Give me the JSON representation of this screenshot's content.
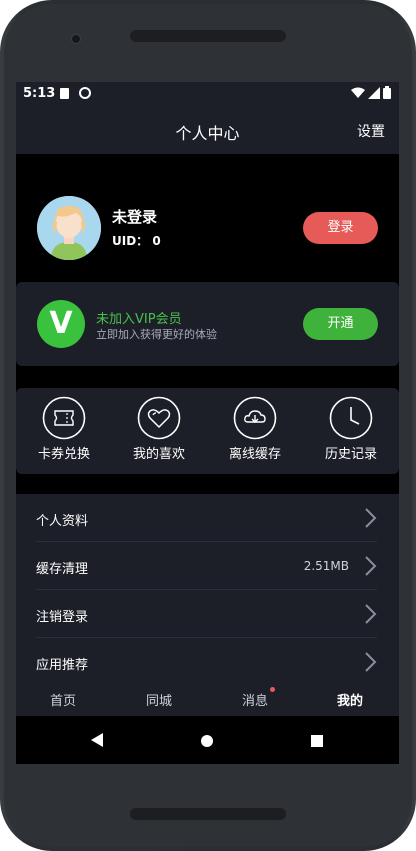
{
  "status_bar": {
    "time": "5:13",
    "icons": [
      "sd-card-icon",
      "do-not-disturb-icon",
      "wifi-icon",
      "signal-icon",
      "battery-icon"
    ]
  },
  "header": {
    "title": "个人中心",
    "settings_label": "设置"
  },
  "profile": {
    "username": "未登录",
    "uid_label": "UID：",
    "uid_value": "0",
    "login_label": "登录",
    "login_color": "#e65b58"
  },
  "vip": {
    "logo_letter": "V",
    "title": "未加入VIP会员",
    "subtitle": "立即加入获得更好的体验",
    "open_label": "开通",
    "accent_color": "#3fb23c"
  },
  "shortcuts": [
    {
      "label": "卡券兑换",
      "icon": "ticket-icon"
    },
    {
      "label": "我的喜欢",
      "icon": "heart-icon"
    },
    {
      "label": "离线缓存",
      "icon": "cloud-download-icon"
    },
    {
      "label": "历史记录",
      "icon": "clock-icon"
    }
  ],
  "menu": [
    {
      "label": "个人资料",
      "value": ""
    },
    {
      "label": "缓存清理",
      "value": "2.51MB"
    },
    {
      "label": "注销登录",
      "value": ""
    },
    {
      "label": "应用推荐",
      "value": ""
    }
  ],
  "tabs": [
    {
      "label": "首页"
    },
    {
      "label": "同城"
    },
    {
      "label": "消息",
      "has_badge": true
    },
    {
      "label": "我的",
      "active": true
    }
  ],
  "nav_bar": [
    "back-icon",
    "home-icon",
    "recents-icon"
  ]
}
